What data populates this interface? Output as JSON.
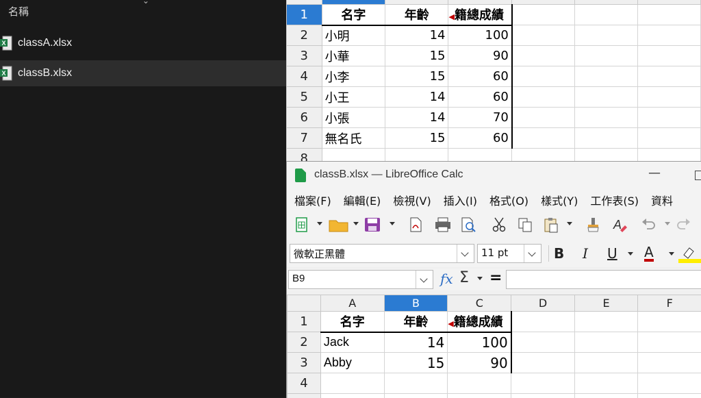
{
  "explorer": {
    "header": "名稱",
    "files": [
      {
        "name": "classA.xlsx",
        "selected": false
      },
      {
        "name": "classB.xlsx",
        "selected": true
      }
    ]
  },
  "background_sheet": {
    "rows": [
      {
        "row": "1",
        "a": "名字",
        "b": "年齡",
        "c": "籍總成績"
      },
      {
        "row": "2",
        "a": "小明",
        "b": "14",
        "c": "100"
      },
      {
        "row": "3",
        "a": "小華",
        "b": "15",
        "c": "90"
      },
      {
        "row": "4",
        "a": "小李",
        "b": "15",
        "c": "60"
      },
      {
        "row": "5",
        "a": "小王",
        "b": "14",
        "c": "60"
      },
      {
        "row": "6",
        "a": "小張",
        "b": "14",
        "c": "70"
      },
      {
        "row": "7",
        "a": "無名氏",
        "b": "15",
        "c": "60"
      },
      {
        "row": "8",
        "a": "",
        "b": "",
        "c": ""
      }
    ]
  },
  "calc_window": {
    "title": "classB.xlsx — LibreOffice Calc",
    "menu": [
      "檔案(F)",
      "編輯(E)",
      "檢視(V)",
      "插入(I)",
      "格式(O)",
      "樣式(Y)",
      "工作表(S)",
      "資料"
    ],
    "font_name": "微軟正黑體",
    "font_size": "11 pt",
    "name_box": "B9",
    "format_buttons": {
      "bold": "B",
      "italic": "I",
      "underline": "U",
      "font_color": "A"
    },
    "columns": [
      "A",
      "B",
      "C",
      "D",
      "E",
      "F"
    ],
    "selected_column": "B",
    "rows": [
      {
        "row": "1",
        "a": "名字",
        "b": "年齡",
        "c": "籍總成績"
      },
      {
        "row": "2",
        "a": "Jack",
        "b": "14",
        "c": "100"
      },
      {
        "row": "3",
        "a": "Abby",
        "b": "15",
        "c": "90"
      },
      {
        "row": "4",
        "a": "",
        "b": "",
        "c": ""
      }
    ]
  },
  "colors": {
    "selection_blue": "#2b7bd2",
    "excel_green": "#1f7b45",
    "calc_green": "#1f9b48",
    "font_color_red": "#c00000",
    "highlight_yellow": "#ffee00"
  }
}
